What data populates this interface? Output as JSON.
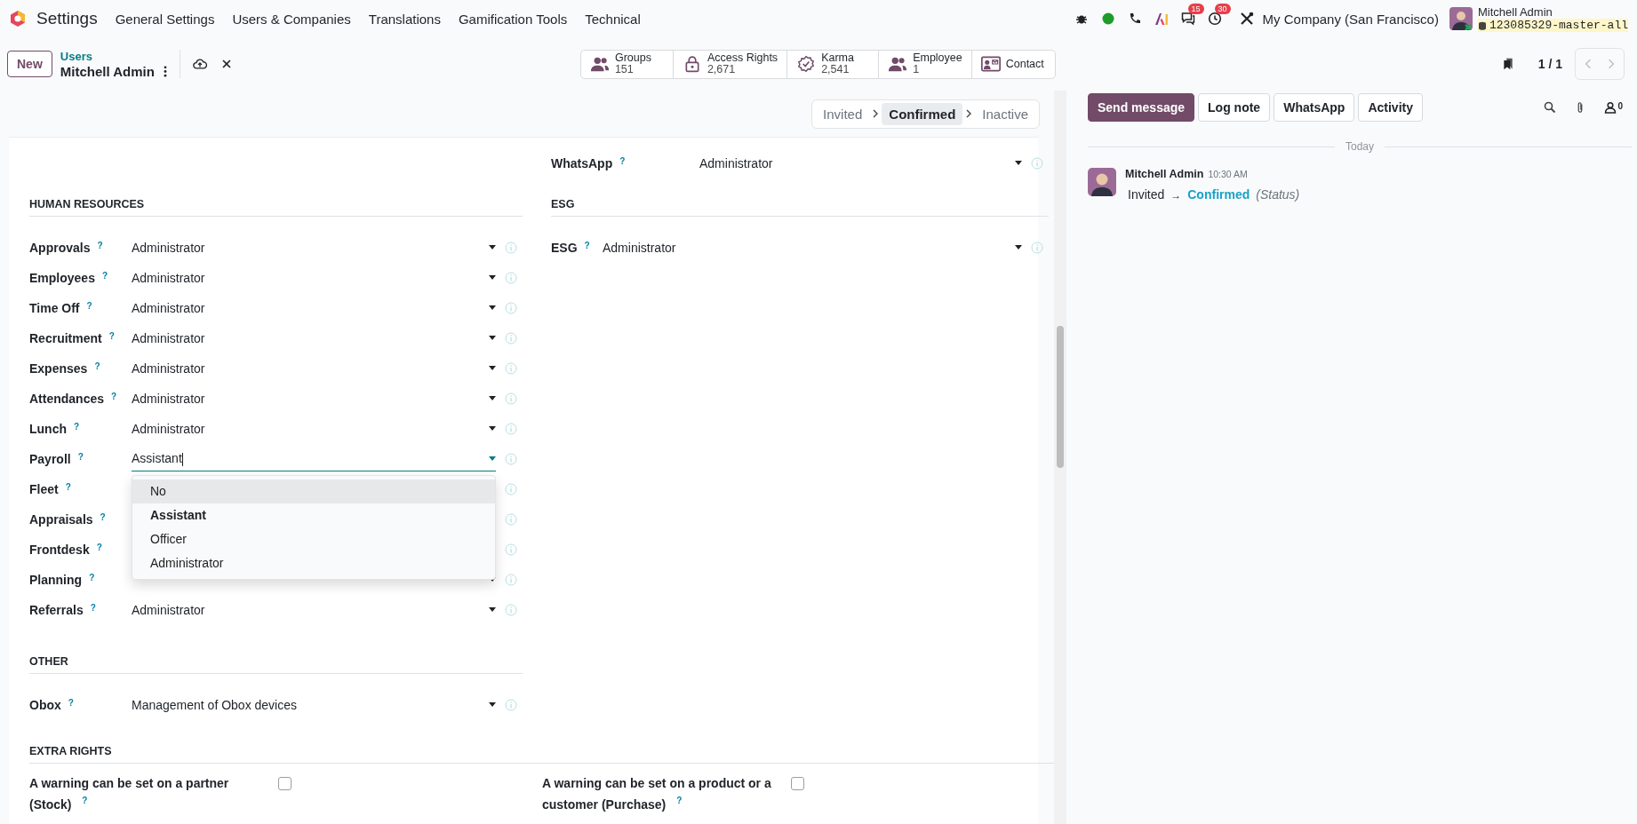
{
  "navbar": {
    "app": "Settings",
    "menu": [
      "General Settings",
      "Users & Companies",
      "Translations",
      "Gamification Tools",
      "Technical"
    ],
    "messages_count": "15",
    "activities_count": "30",
    "company": "My Company (San Francisco)",
    "user": "Mitchell Admin",
    "database": "123085329-master-all"
  },
  "control_panel": {
    "new_button": "New",
    "breadcrumb_parent": "Users",
    "breadcrumb_current": "Mitchell Admin",
    "pager": "1 / 1"
  },
  "smart_buttons": [
    {
      "kind": "users",
      "label": "Groups",
      "value": "151"
    },
    {
      "kind": "lock",
      "label": "Access Rights",
      "value": "2,671"
    },
    {
      "kind": "badge",
      "label": "Karma",
      "value": "2,541"
    },
    {
      "kind": "users",
      "label": "Employee",
      "value": "1"
    },
    {
      "kind": "card",
      "label": "Contact"
    }
  ],
  "statusbar": [
    {
      "label": "Invited",
      "selected": false
    },
    {
      "label": "Confirmed",
      "selected": true
    },
    {
      "label": "Inactive",
      "selected": false
    }
  ],
  "form": {
    "top_rows": [
      {
        "label": "WhatsApp",
        "help": "?",
        "value": "Administrator",
        "focused": false
      }
    ],
    "left_sections": [
      {
        "title": "HUMAN RESOURCES",
        "rows": [
          {
            "label": "Approvals",
            "help": "?",
            "value": "Administrator",
            "focused": false
          },
          {
            "label": "Employees",
            "help": "?",
            "value": "Administrator",
            "focused": false
          },
          {
            "label": "Time Off",
            "help": "?",
            "value": "Administrator",
            "focused": false
          },
          {
            "label": "Recruitment",
            "help": "?",
            "value": "Administrator",
            "focused": false
          },
          {
            "label": "Expenses",
            "help": "?",
            "value": "Administrator",
            "focused": false
          },
          {
            "label": "Attendances",
            "help": "?",
            "value": "Administrator",
            "focused": false
          },
          {
            "label": "Lunch",
            "help": "?",
            "value": "Administrator",
            "focused": false
          },
          {
            "label": "Payroll",
            "help": "?",
            "value": "Assistant",
            "focused": true,
            "options": [
              {
                "label": "No",
                "selected": false,
                "highlighted": true
              },
              {
                "label": "Assistant",
                "selected": true,
                "highlighted": false
              },
              {
                "label": "Officer",
                "selected": false,
                "highlighted": false
              },
              {
                "label": "Administrator",
                "selected": false,
                "highlighted": false
              }
            ]
          },
          {
            "label": "Fleet",
            "help": "?"
          },
          {
            "label": "Appraisals",
            "help": "?"
          },
          {
            "label": "Frontdesk",
            "help": "?"
          },
          {
            "label": "Planning",
            "help": "?"
          },
          {
            "label": "Referrals",
            "help": "?",
            "value": "Administrator",
            "focused": false
          }
        ]
      },
      {
        "title": "OTHER",
        "rows": [
          {
            "label": "Obox",
            "help": "?",
            "value": "Management of Obox devices",
            "focused": false
          }
        ]
      }
    ],
    "right_sections": [
      {
        "title": "ESG",
        "rows": [
          {
            "label": "ESG",
            "help": "?",
            "value": "Administrator",
            "focused": false
          }
        ]
      }
    ],
    "extra_rights": {
      "title": "EXTRA RIGHTS",
      "items": [
        {
          "label": "A warning can be set on a partner (Stock)",
          "help": "?",
          "checked": false
        },
        {
          "label": "A warning can be set on a product or a customer (Purchase)",
          "help": "?",
          "checked": false
        }
      ]
    }
  },
  "chatter": {
    "buttons": [
      {
        "label": "Send message",
        "selected": true
      },
      {
        "label": "Log note",
        "selected": false
      },
      {
        "label": "WhatsApp",
        "selected": false
      },
      {
        "label": "Activity",
        "selected": false
      }
    ],
    "follower_count": "0",
    "date_separator": "Today",
    "messages": [
      {
        "author": "Mitchell Admin",
        "time": "10:30 AM",
        "old_value": "Invited",
        "arrow": "→",
        "new_value": "Confirmed",
        "field": "(Status)"
      }
    ]
  }
}
